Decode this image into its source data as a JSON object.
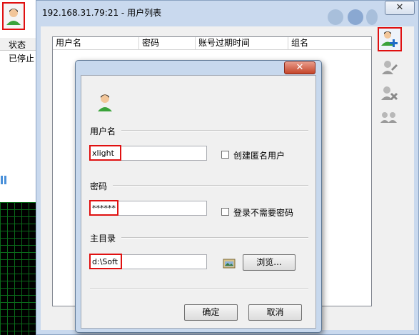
{
  "background": {
    "status_header": "状态",
    "status_value": "已停止"
  },
  "user_window": {
    "title": "192.168.31.79:21 - 用户列表",
    "close_glyph": "✕",
    "columns": [
      "用户名",
      "密码",
      "账号过期时间",
      "组名"
    ],
    "toolbar": [
      "add-user-icon",
      "edit-user-icon",
      "delete-user-icon",
      "group-users-icon"
    ]
  },
  "dialog": {
    "close_glyph": "✕",
    "username_section": "用户名",
    "username_value": "xlight",
    "anonymous_label": "创建匿名用户",
    "password_section": "密码",
    "password_value": "******",
    "no_password_label": "登录不需要密码",
    "homedir_section": "主目录",
    "homedir_value": "d:\\Soft",
    "browse_label": "浏览...",
    "ok_label": "确定",
    "cancel_label": "取消"
  },
  "colors": {
    "highlight": "#e01010",
    "title_bar": "#c9d9ee",
    "close_button": "#c4452a"
  }
}
